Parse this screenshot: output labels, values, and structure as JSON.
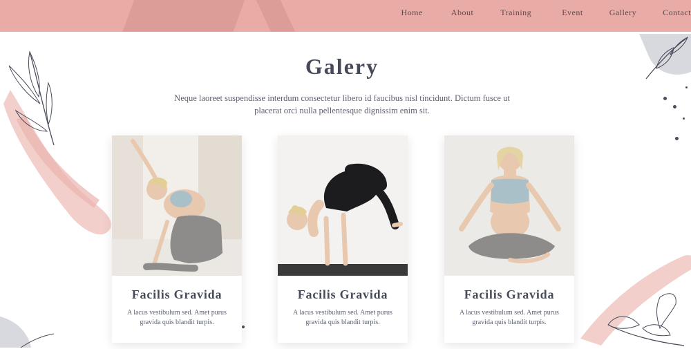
{
  "nav": {
    "items": [
      "Home",
      "About",
      "Training",
      "Event",
      "Gallery",
      "Contact"
    ]
  },
  "page": {
    "title": "Galery",
    "intro": "Neque laoreet suspendisse interdum consectetur libero id faucibus nisl tincidunt. Dictum fusce ut placerat orci nulla pellentesque dignissim enim sit."
  },
  "cards": [
    {
      "title": "Facilis Gravida",
      "desc": "A lacus vestibulum sed. Amet purus gravida quis blandit turpis.",
      "photo": "side-stretch-pose"
    },
    {
      "title": "Facilis Gravida",
      "desc": "A lacus vestibulum sed. Amet purus gravida quis blandit turpis.",
      "photo": "crow-pose"
    },
    {
      "title": "Facilis Gravida",
      "desc": "A lacus vestibulum sed. Amet purus gravida quis blandit turpis.",
      "photo": "seated-meditation"
    }
  ],
  "colors": {
    "header": "#e9aba5",
    "brush": "#f0c4c0",
    "text": "#474b59"
  }
}
